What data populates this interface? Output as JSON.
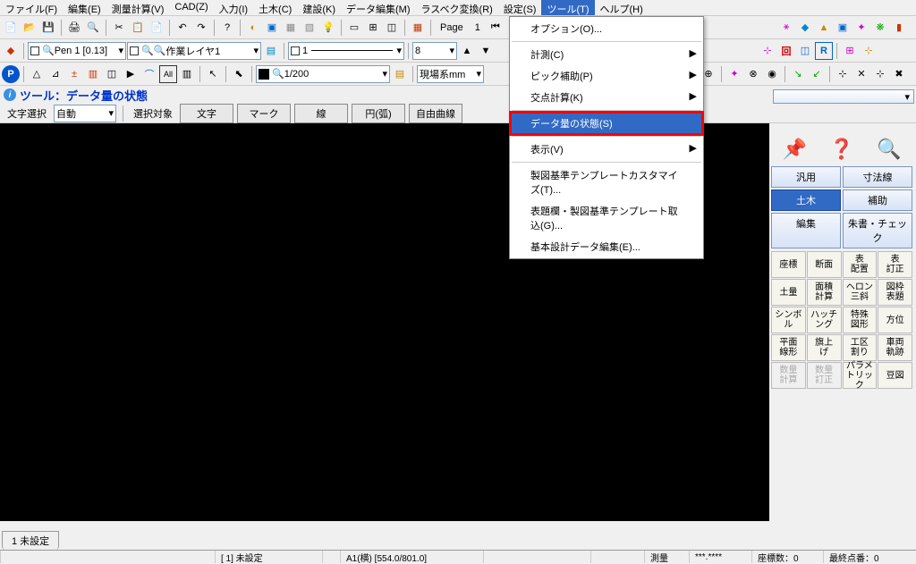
{
  "menus": [
    "ファイル(F)",
    "編集(E)",
    "測量計算(V)",
    "CAD(Z)",
    "入力(I)",
    "土木(C)",
    "建設(K)",
    "データ編集(M)",
    "ラスベク変換(R)",
    "設定(S)",
    "ツール(T)",
    "ヘルプ(H)"
  ],
  "active_menu_index": 10,
  "dropdown": {
    "items": [
      {
        "label": "オプション(O)...",
        "type": "item"
      },
      {
        "type": "sep"
      },
      {
        "label": "計測(C)",
        "type": "sub"
      },
      {
        "label": "ピック補助(P)",
        "type": "sub"
      },
      {
        "label": "交点計算(K)",
        "type": "sub"
      },
      {
        "type": "sep"
      },
      {
        "label": "データ量の状態(S)",
        "type": "item",
        "highlighted": true,
        "red_box": true
      },
      {
        "type": "sep"
      },
      {
        "label": "表示(V)",
        "type": "sub"
      },
      {
        "type": "sep"
      },
      {
        "label": "製図基準テンプレートカスタマイズ(T)...",
        "type": "item"
      },
      {
        "label": "表題欄・製図基準テンプレート取込(G)...",
        "type": "item"
      },
      {
        "label": "基本設計データ編集(E)...",
        "type": "item"
      }
    ]
  },
  "toolbar1": {
    "page_label": "Page",
    "page_value": "1"
  },
  "toolbar2": {
    "pen_label": "Pen 1",
    "pen_size": "[0.13]",
    "layer_display": "作業レイヤ1",
    "line_type": "1",
    "num": "8"
  },
  "toolbar3": {
    "scale": "1/200",
    "coord_sys": "現場系mm"
  },
  "tool_title": "ツール：データ量の状態",
  "select_bar": {
    "label": "文字選択",
    "target_label": "選択対象",
    "combo": "自動",
    "buttons": [
      "文字",
      "マーク",
      "線",
      "円(弧)",
      "自由曲線"
    ]
  },
  "right_panel": {
    "tabs": [
      [
        "汎用",
        "寸法線"
      ],
      [
        "土木",
        "補助"
      ],
      [
        "編集",
        "朱書・チェック"
      ]
    ],
    "selected_row": 1,
    "selected_col": 0,
    "grid": [
      [
        "座標",
        "断面",
        "表\n配置",
        "表\n訂正"
      ],
      [
        "土量",
        "面積\n計算",
        "ヘロン\n三斜",
        "図枠\n表題"
      ],
      [
        "シンボ\nル",
        "ハッチ\nング",
        "特殊\n図形",
        "方位"
      ],
      [
        "平面\n線形",
        "旗上\nげ",
        "工区\n割り",
        "車両\n軌跡"
      ],
      [
        "数量\n計算",
        "数量\n訂正",
        "パラメ\nトリック",
        "豆図"
      ]
    ],
    "disabled": [
      [
        4,
        0
      ],
      [
        4,
        1
      ]
    ]
  },
  "bottom_tab": "1 未設定",
  "statusbar": {
    "cells": [
      "",
      "[  1] 未設定",
      "",
      "A1(横)  [554.0/801.0]",
      "",
      "",
      "測量",
      "***.****",
      "座標数：0",
      "最終点番：0"
    ]
  },
  "colors": {
    "accent": "#316ac5",
    "red": "#ff0000"
  }
}
